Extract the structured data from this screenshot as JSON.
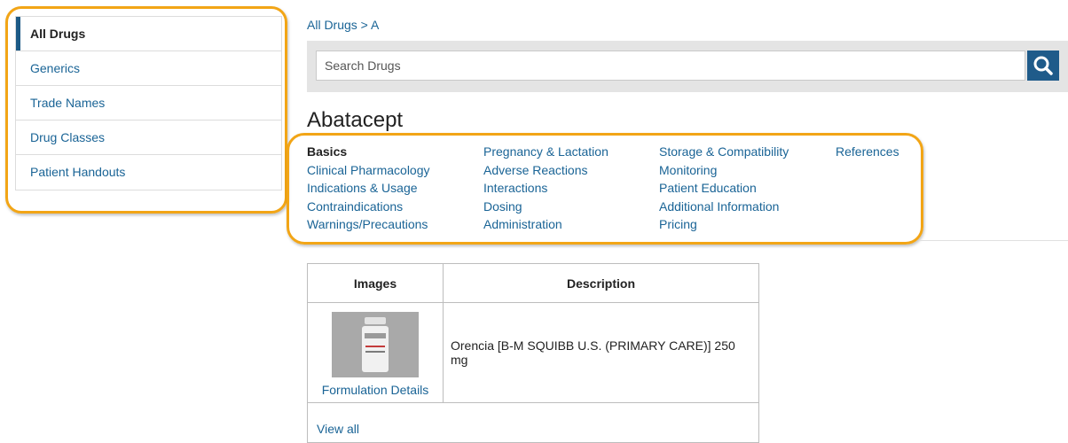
{
  "sidebar": {
    "items": [
      {
        "label": "All Drugs",
        "active": true
      },
      {
        "label": "Generics",
        "active": false
      },
      {
        "label": "Trade Names",
        "active": false
      },
      {
        "label": "Drug Classes",
        "active": false
      },
      {
        "label": "Patient Handouts",
        "active": false
      }
    ]
  },
  "breadcrumb": "All Drugs > A",
  "search": {
    "placeholder": "Search Drugs",
    "value": ""
  },
  "drug": {
    "title": "Abatacept"
  },
  "sections": {
    "col1": [
      "Basics",
      "Clinical Pharmacology",
      "Indications & Usage",
      "Contraindications",
      "Warnings/Precautions"
    ],
    "col2": [
      "Pregnancy & Lactation",
      "Adverse Reactions",
      "Interactions",
      "Dosing",
      "Administration"
    ],
    "col3": [
      "Storage & Compatibility",
      "Monitoring",
      "Patient Education",
      "Additional Information",
      "Pricing"
    ],
    "col4": [
      "References"
    ],
    "active": "Basics"
  },
  "table": {
    "headers": {
      "images": "Images",
      "description": "Description"
    },
    "rows": [
      {
        "link": "Formulation Details",
        "description": "Orencia [B-M SQUIBB U.S. (PRIMARY CARE)] 250 mg"
      }
    ],
    "view_all": "View all"
  },
  "colors": {
    "accent": "#1f5b8a",
    "link": "#1a6496",
    "highlight": "#f2a516"
  },
  "icons": {
    "search": "search-icon"
  }
}
